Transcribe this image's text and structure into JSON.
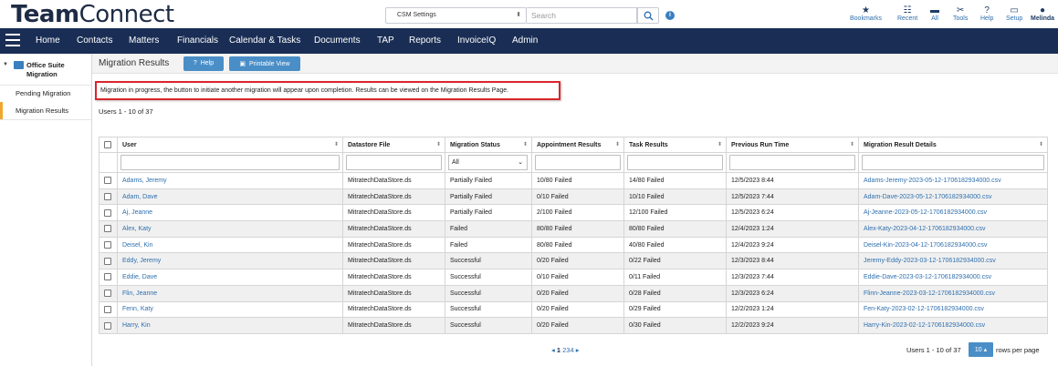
{
  "brand": {
    "part1": "Team",
    "part2": "Connect"
  },
  "top": {
    "context_select": "CSM Settings",
    "search_placeholder": "Search",
    "items": [
      {
        "icon": "star-icon",
        "glyph": "★",
        "label": "Bookmarks"
      },
      {
        "icon": "recent-icon",
        "glyph": "☷",
        "label": "Recent"
      },
      {
        "icon": "folder-icon",
        "glyph": "▬",
        "label": "All"
      },
      {
        "icon": "tools-icon",
        "glyph": "✂",
        "label": "Tools"
      },
      {
        "icon": "help-icon",
        "glyph": "?",
        "label": "Help"
      },
      {
        "icon": "setup-icon",
        "glyph": "▭",
        "label": "Setup"
      },
      {
        "icon": "user-icon",
        "glyph": "●",
        "label": "Melinda"
      }
    ]
  },
  "nav": [
    "Home",
    "Contacts",
    "Matters",
    "Financials",
    "Calendar & Tasks",
    "Documents",
    "TAP",
    "Reports",
    "InvoiceIQ",
    "Admin"
  ],
  "sidebar": {
    "header": "Office Suite Migration",
    "items": [
      "Pending Migration",
      "Migration Results"
    ],
    "active_index": 1
  },
  "page": {
    "title": "Migration Results",
    "help_label": "Help",
    "print_label": "Printable View",
    "alert": "Migration in progress, the button to initiate another migration will appear upon completion. Results can be viewed on the Migration Results Page.",
    "users_count": "Users 1 - 10 of 37"
  },
  "table": {
    "columns": [
      "User",
      "Datastore File",
      "Migration Status",
      "Appointment Results",
      "Task Results",
      "Previous Run Time",
      "Migration Result Details"
    ],
    "status_filter": "All",
    "rows": [
      [
        "Adams, Jeremy",
        "MitratechDataStore.ds",
        "Partially Failed",
        "10/80 Failed",
        "14/80 Failed",
        "12/5/2023 8:44",
        "Adams-Jeremy-2023-05-12-1706182934000.csv"
      ],
      [
        "Adam, Dave",
        "MitratechDataStore.ds",
        "Partially Failed",
        "0/10 Failed",
        "10/10 Failed",
        "12/5/2023 7:44",
        "Adam-Dave-2023-05-12-1706182934000.csv"
      ],
      [
        "Aj, Jeanne",
        "MitratechDataStore.ds",
        "Partially Failed",
        "2/100 Failed",
        "12/100 Failed",
        "12/5/2023 6:24",
        "Aj-Jeanne-2023-05-12-1706182934000.csv"
      ],
      [
        "Alex, Katy",
        "MitratechDataStore.ds",
        "Failed",
        "80/80 Failed",
        "80/80 Failed",
        "12/4/2023 1:24",
        "Alex-Katy-2023-04-12-1706182934000.csv"
      ],
      [
        "Deisel, Kin",
        "MitratechDataStore.ds",
        "Failed",
        "80/80 Failed",
        "40/80 Failed",
        "12/4/2023 9:24",
        "Deisel-Kin-2023-04-12-1706182934000.csv"
      ],
      [
        "Eddy, Jeremy",
        "MitratechDataStore.ds",
        "Successful",
        "0/20 Failed",
        "0/22 Failed",
        "12/3/2023 8:44",
        "Jeremy-Eddy-2023-03-12-1706182934000.csv"
      ],
      [
        "Eddie, Dave",
        "MitratechDataStore.ds",
        "Successful",
        "0/10 Failed",
        "0/11 Failed",
        "12/3/2023 7:44",
        "Eddie-Dave-2023-03-12-1706182934000.csv"
      ],
      [
        "Flin, Jeanne",
        "MitratechDataStore.ds",
        "Successful",
        "0/20 Failed",
        "0/28 Failed",
        "12/3/2023 6:24",
        "Flinn-Jeanne-2023-03-12-1706182934000.csv"
      ],
      [
        "Fenn, Katy",
        "MitratechDataStore.ds",
        "Successful",
        "0/20 Failed",
        "0/29 Failed",
        "12/2/2023 1:24",
        "Fen-Katy-2023-02-12-1706182934000.csv"
      ],
      [
        "Harry, Kin",
        "MitratechDataStore.ds",
        "Successful",
        "0/20 Failed",
        "0/30 Failed",
        "12/2/2023 9:24",
        "Harry-Kin-2023-02-12-1706182934000.csv"
      ]
    ]
  },
  "pager": {
    "pages": [
      "1",
      "2",
      "3",
      "4"
    ],
    "prev": "◂",
    "next": "▸",
    "rows_info": "Users  1 - 10 of 37",
    "rows_per_page": "10 ▴",
    "rows_per_page_label": "rows per page"
  },
  "colors": {
    "nav_bg": "#1a2e55",
    "accent": "#4a8ec7",
    "link": "#2e6fae",
    "alert_border": "#d9262c",
    "active_marker": "#f0a830"
  }
}
